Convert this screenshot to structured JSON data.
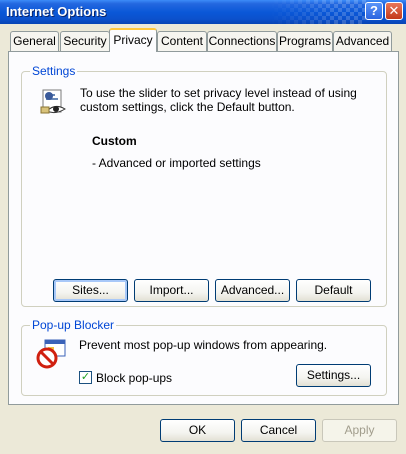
{
  "window": {
    "title": "Internet Options",
    "help_glyph": "?",
    "close_glyph": "✕"
  },
  "tabs": [
    {
      "label": "General"
    },
    {
      "label": "Security"
    },
    {
      "label": "Privacy",
      "active": true
    },
    {
      "label": "Content"
    },
    {
      "label": "Connections"
    },
    {
      "label": "Programs"
    },
    {
      "label": "Advanced"
    }
  ],
  "settings": {
    "group_label": "Settings",
    "description": "To use the slider to set privacy level instead of using custom settings, click the Default button.",
    "level_title": "Custom",
    "level_detail": "- Advanced or imported settings",
    "buttons": {
      "sites": "Sites...",
      "import": "Import...",
      "advanced": "Advanced...",
      "default": "Default"
    }
  },
  "popup_blocker": {
    "group_label": "Pop-up Blocker",
    "description": "Prevent most pop-up windows from appearing.",
    "checkbox_label": "Block pop-ups",
    "checkbox_checked": true,
    "settings_button": "Settings..."
  },
  "footer": {
    "ok": "OK",
    "cancel": "Cancel",
    "apply": "Apply"
  },
  "icons": {
    "privacy": "privacy-eye-icon",
    "popup": "popup-blocker-icon"
  },
  "colors": {
    "titlebar": "#0a58d8",
    "dialog_bg": "#ECE9D8",
    "group_label": "#0046d5",
    "active_tab_accent": "#ffc83c"
  }
}
